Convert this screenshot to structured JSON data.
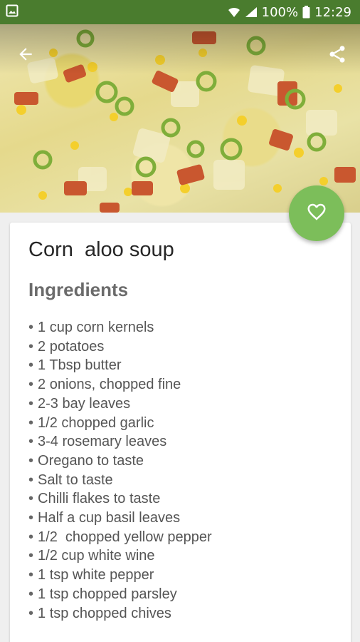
{
  "status_bar": {
    "battery": "100%",
    "time": "12:29",
    "icons": [
      "image-icon",
      "wifi-icon",
      "signal-icon",
      "battery-icon"
    ]
  },
  "header": {
    "back_icon": "arrow-back-icon",
    "share_icon": "share-icon"
  },
  "fab": {
    "icon": "heart-outline-icon"
  },
  "recipe": {
    "title": "Corn  aloo soup",
    "ingredients_heading": "Ingredients",
    "ingredients": [
      "1 cup corn kernels",
      "2 potatoes",
      "1 Tbsp butter",
      "2 onions, chopped fine",
      "2-3 bay leaves",
      "1/2 chopped garlic",
      "3-4 rosemary leaves",
      "Oregano to taste",
      "Salt to taste",
      "Chilli flakes to taste",
      "Half a cup basil leaves",
      "1/2  chopped yellow pepper",
      "1/2 cup white wine",
      "1 tsp white pepper",
      "1 tsp chopped parsley",
      "1 tsp chopped chives"
    ]
  },
  "colors": {
    "status_bar": "#4a7c2e",
    "fab": "#7cbe5a",
    "heading": "#6b6b6b"
  }
}
